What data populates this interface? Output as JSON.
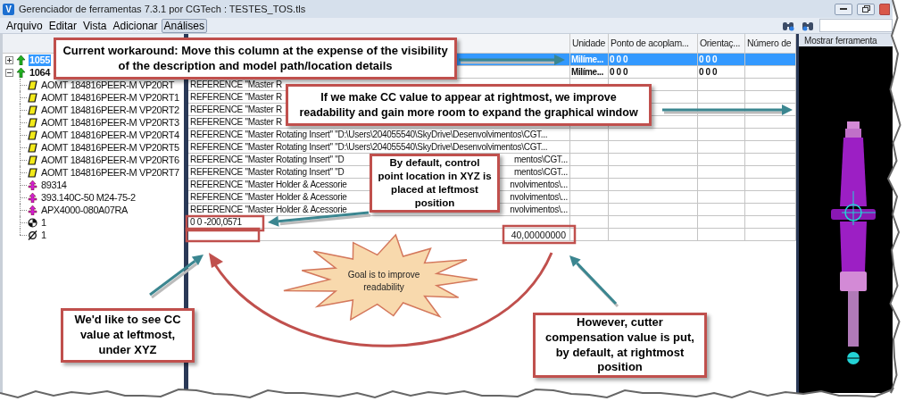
{
  "window": {
    "icon_letter": "V",
    "title": "Gerenciador de ferramentas 7.3.1 por CGTech : TESTES_TOS.tls"
  },
  "menu": [
    {
      "label": "Arquivo",
      "selected": false
    },
    {
      "label": "Editar",
      "selected": false
    },
    {
      "label": "Vista",
      "selected": false
    },
    {
      "label": "Adicionar",
      "selected": false
    },
    {
      "label": "Análises",
      "selected": true
    }
  ],
  "table": {
    "columns": [
      "Unidade",
      "Ponto de acoplam...",
      "Orientaç...",
      "Número de"
    ],
    "rows": [
      {
        "kind": "tool",
        "label": "1055",
        "expanded": false,
        "selected": true,
        "unit": "Milíme...",
        "coupling": "0 0 0",
        "orientation": "0 0 0"
      },
      {
        "kind": "tool",
        "label": "1064",
        "expanded": true,
        "selected": false,
        "unit": "Milíme...",
        "coupling": "0 0 0",
        "orientation": "0 0 0",
        "children": [
          {
            "kind": "insert",
            "label": "AOMT 184816PEER-M VP20RT",
            "selected": false,
            "description": "REFERENCE \"Master R"
          },
          {
            "kind": "insert",
            "label": "AOMT 184816PEER-M VP20RT1",
            "selected": false,
            "description": "REFERENCE \"Master R"
          },
          {
            "kind": "insert",
            "label": "AOMT 184816PEER-M VP20RT2",
            "selected": false,
            "description": "REFERENCE \"Master R"
          },
          {
            "kind": "insert",
            "label": "AOMT 184816PEER-M VP20RT3",
            "selected": false,
            "description": "REFERENCE \"Master R"
          },
          {
            "kind": "insert",
            "label": "AOMT 184816PEER-M VP20RT4",
            "selected": false,
            "description": "REFERENCE \"Master Rotating Insert\" \"D:\\Users\\204055540\\SkyDrive\\Desenvolvimentos\\CGT..."
          },
          {
            "kind": "insert",
            "label": "AOMT 184816PEER-M VP20RT5",
            "selected": false,
            "description": "REFERENCE \"Master Rotating Insert\" \"D:\\Users\\204055540\\SkyDrive\\Desenvolvimentos\\CGT..."
          },
          {
            "kind": "insert",
            "label": "AOMT 184816PEER-M VP20RT6",
            "selected": false,
            "description": "REFERENCE \"Master Rotating Insert\" \"D",
            "description_tail": "mentos\\CGT..."
          },
          {
            "kind": "insert",
            "label": "AOMT 184816PEER-M VP20RT7",
            "selected": false,
            "description": "REFERENCE \"Master Rotating Insert\" \"D",
            "description_tail": "mentos\\CGT..."
          },
          {
            "kind": "holder",
            "label": "89314",
            "selected": false,
            "description": "REFERENCE \"Master Holder & Acessorie",
            "description_tail": "nvolvimentos\\..."
          },
          {
            "kind": "holder",
            "label": "393.140C-50 M24-75-2",
            "selected": false,
            "description": "REFERENCE \"Master Holder & Acessorie",
            "description_tail": "nvolvimentos\\..."
          },
          {
            "kind": "holder",
            "label": "APX4000-080A07RA",
            "selected": false,
            "description": "REFERENCE \"Master Holder & Acessorie",
            "description_tail": "nvolvimentos\\..."
          },
          {
            "kind": "point",
            "label": "1",
            "selected": false,
            "description": "0 0 -200,0571"
          },
          {
            "kind": "diameter",
            "label": "1",
            "selected": false,
            "compensation": "40,00000000"
          }
        ]
      }
    ]
  },
  "graphics_panel": {
    "header": "Mostrar ferramenta"
  },
  "annotations": [
    {
      "kind": "callout",
      "text": "Current workaround: Move this column at the expense of the visibility of the description and model path/location details"
    },
    {
      "kind": "callout",
      "text": "If we make CC value to appear at rightmost, we improve readability and gain more room to expand the graphical window"
    },
    {
      "kind": "callout",
      "text": "By default, control point location in XYZ is placed at leftmost position"
    },
    {
      "kind": "burst",
      "text": "Goal is to improve readability"
    },
    {
      "kind": "callout",
      "text": "We'd like to see CC value at leftmost, under XYZ"
    },
    {
      "kind": "callout",
      "text": "However, cutter compensation value is put, by default, at rightmost position"
    }
  ]
}
